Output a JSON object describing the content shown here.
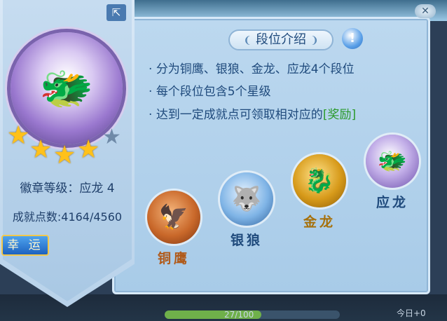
{
  "bottom": {
    "progress_text": "27/100",
    "progress_fraction": 0.55,
    "right_text": "今日+0"
  },
  "close": {
    "icon": "close-icon"
  },
  "title": {
    "text": "段位介绍",
    "info_icon": "!"
  },
  "description": {
    "lines": [
      "分为铜鹰、银狼、金龙、应龙4个段位",
      "每个段位包含5个星级",
      "达到一定成就点可领取相对应的"
    ],
    "reward_label": "[奖励]"
  },
  "badge": {
    "share_icon": "⇱",
    "stars_filled": 4,
    "stars_total": 5,
    "level_text": "徽章等级：应龙 4",
    "points_text": "成就点数:4164/4560",
    "luck_button": "幸 运"
  },
  "tiers": [
    {
      "label": "铜鹰",
      "color": "#c9682a"
    },
    {
      "label": "银狼",
      "color": "#4f8fcf"
    },
    {
      "label": "金龙",
      "color": "#d79a1a"
    },
    {
      "label": "应龙",
      "color": "#8a68c9"
    }
  ],
  "colors": {
    "accent": "#1f4a7c",
    "reward": "#2a9a2a",
    "star": "#ffc11a"
  }
}
